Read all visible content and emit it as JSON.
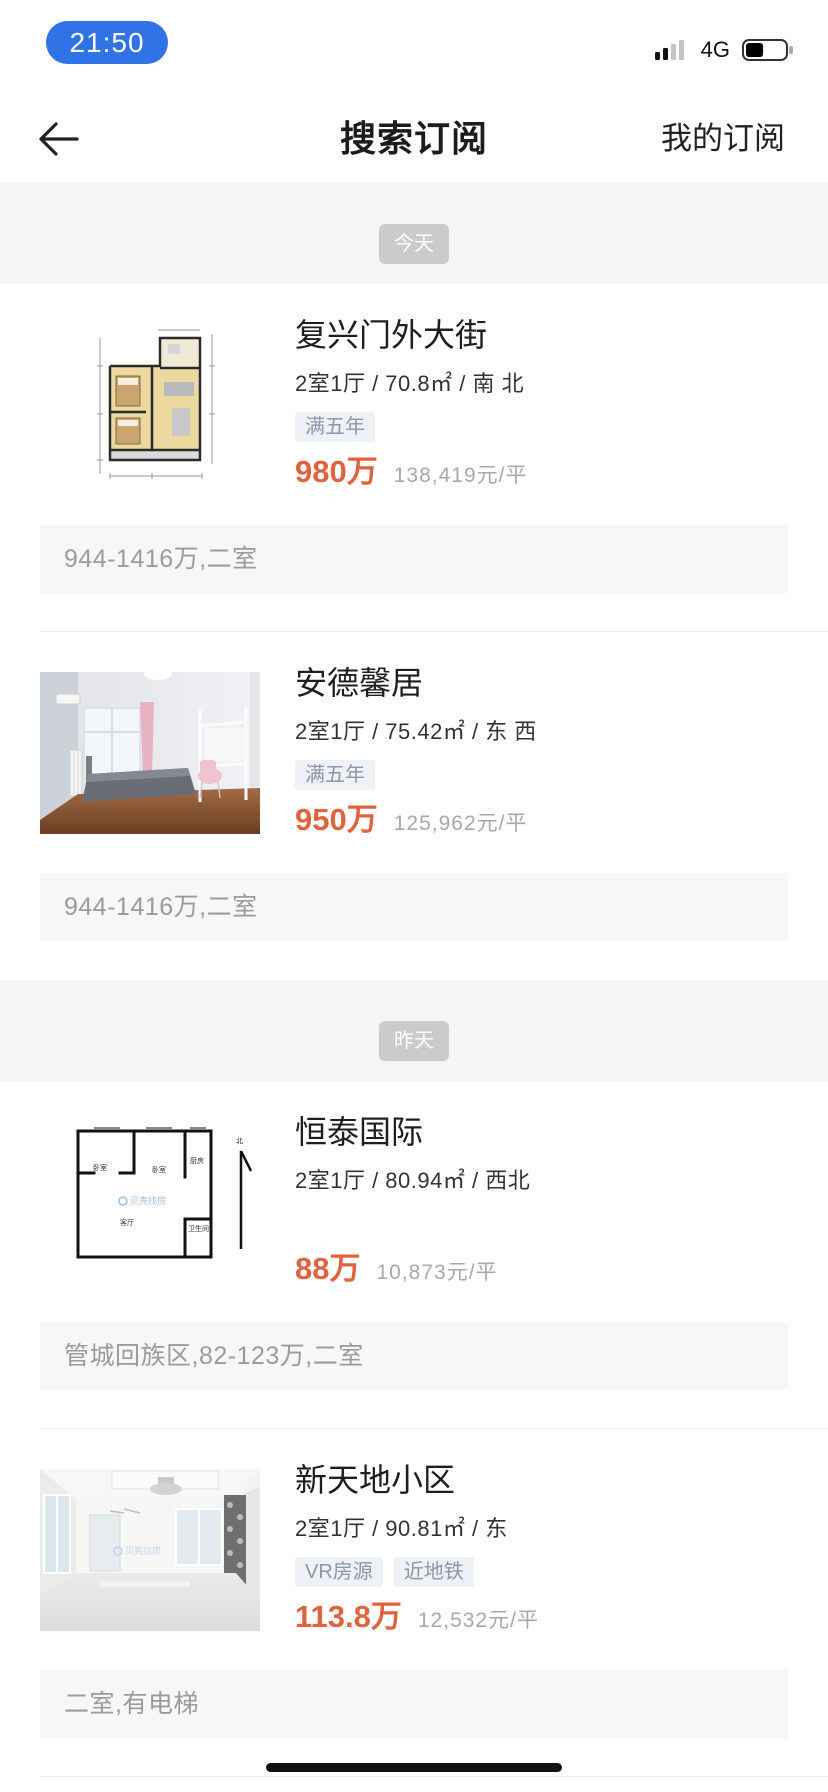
{
  "status_bar": {
    "time": "21:50",
    "network": "4G",
    "signal_icon": "signal-icon",
    "battery_icon": "battery-icon",
    "battery_level": 0.45
  },
  "nav": {
    "back_icon": "back-arrow-icon",
    "title": "搜索订阅",
    "right_label": "我的订阅"
  },
  "sections": [
    {
      "label": "今天",
      "listings": [
        {
          "title": "复兴门外大街",
          "details": "2室1厅 / 70.8㎡ / 南 北",
          "tags": [
            "满五年"
          ],
          "price": "980万",
          "unit_price": "138,419元/平",
          "criteria": "944-1416万,二室"
        },
        {
          "title": "安德馨居",
          "details": "2室1厅 / 75.42㎡ / 东 西",
          "tags": [
            "满五年"
          ],
          "price": "950万",
          "unit_price": "125,962元/平",
          "criteria": "944-1416万,二室"
        }
      ]
    },
    {
      "label": "昨天",
      "listings": [
        {
          "title": "恒泰国际",
          "details": "2室1厅 / 80.94㎡ / 西北",
          "tags": [],
          "price": "88万",
          "unit_price": "10,873元/平",
          "criteria": "管城回族区,82-123万,二室",
          "floor_plan_labels": [
            "卧室",
            "卧室",
            "厨房",
            "客厅",
            "卫生间",
            "北"
          ]
        },
        {
          "title": "新天地小区",
          "details": "2室1厅 / 90.81㎡ / 东",
          "tags": [
            "VR房源",
            "近地铁"
          ],
          "price": "113.8万",
          "unit_price": "12,532元/平",
          "criteria": "二室,有电梯"
        }
      ]
    }
  ],
  "watermark": "贝壳找房",
  "colors": {
    "time_pill": "#2F73E6",
    "price": "#E1623E",
    "tag_bg": "#EEF1F5",
    "tag_text": "#8C97A6",
    "date_badge_bg": "#CBCBCB",
    "section_bg": "#F5F5F5",
    "criteria_bg": "#F7F7F7",
    "criteria_text": "#9B9B9B"
  }
}
